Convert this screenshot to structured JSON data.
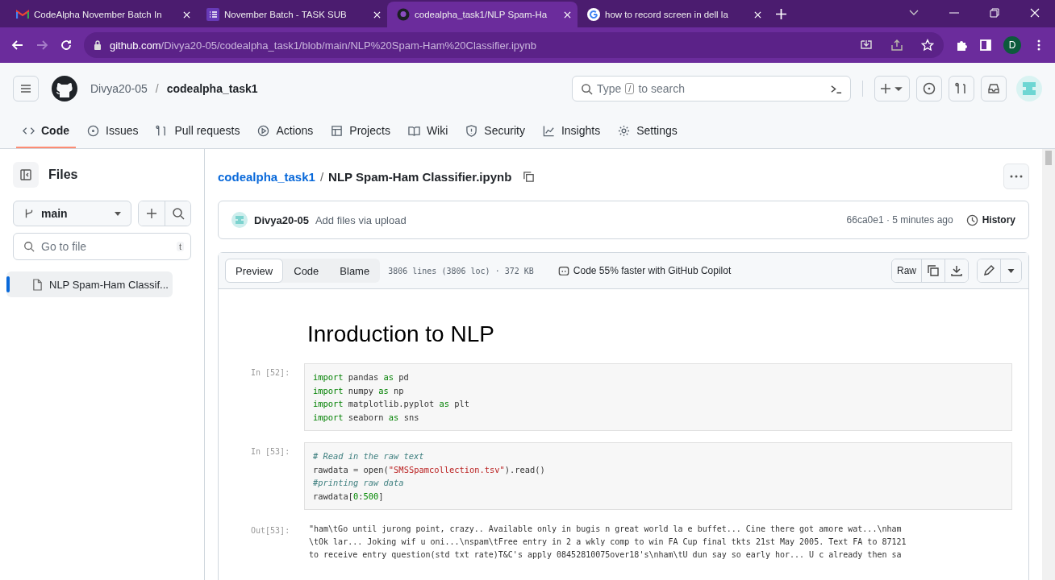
{
  "browser": {
    "tabs": [
      {
        "title": "CodeAlpha November Batch In",
        "selected": false
      },
      {
        "title": "November Batch - TASK SUB",
        "selected": false
      },
      {
        "title": "codealpha_task1/NLP Spam-Ha",
        "selected": true
      },
      {
        "title": "how to record screen in dell la",
        "selected": false
      }
    ],
    "url_host": "github.com",
    "url_path": "/Divya20-05/codealpha_task1/blob/main/NLP%20Spam-Ham%20Classifier.ipynb",
    "profile_initial": "D"
  },
  "header": {
    "owner": "Divya20-05",
    "separator": "/",
    "repo": "codealpha_task1",
    "search_placeholder_before": "Type",
    "search_key": "/",
    "search_placeholder_after": "to search"
  },
  "repo_nav": [
    {
      "label": "Code",
      "selected": true
    },
    {
      "label": "Issues",
      "selected": false
    },
    {
      "label": "Pull requests",
      "selected": false
    },
    {
      "label": "Actions",
      "selected": false
    },
    {
      "label": "Projects",
      "selected": false
    },
    {
      "label": "Wiki",
      "selected": false
    },
    {
      "label": "Security",
      "selected": false
    },
    {
      "label": "Insights",
      "selected": false
    },
    {
      "label": "Settings",
      "selected": false
    }
  ],
  "sidebar": {
    "title": "Files",
    "branch": "main",
    "filter_placeholder": "Go to file",
    "filter_key": "t",
    "files": [
      {
        "name": "NLP Spam-Ham Classif...",
        "selected": true
      }
    ]
  },
  "file": {
    "repo_link": "codealpha_task1",
    "separator": "/",
    "name": "NLP Spam-Ham Classifier.ipynb",
    "commit": {
      "author": "Divya20-05",
      "message": "Add files via upload",
      "hash_time": "66ca0e1 · 5 minutes ago",
      "history": "History"
    },
    "view_tabs": [
      {
        "label": "Preview",
        "selected": true
      },
      {
        "label": "Code",
        "selected": false
      },
      {
        "label": "Blame",
        "selected": false
      }
    ],
    "stats": "3806 lines (3806 loc) · 372 KB",
    "copilot": "Code 55% faster with GitHub Copilot",
    "raw": "Raw"
  },
  "notebook": {
    "heading": "Inroduction to NLP",
    "cells": [
      {
        "prompt": "In [52]:",
        "kind": "input",
        "lines": [
          [
            {
              "t": "import",
              "kind": "keyword"
            },
            {
              "t": " pandas ",
              "kind": "plain"
            },
            {
              "t": "as",
              "kind": "keyword"
            },
            {
              "t": " pd",
              "kind": "plain"
            }
          ],
          [
            {
              "t": "import",
              "kind": "keyword"
            },
            {
              "t": " numpy ",
              "kind": "plain"
            },
            {
              "t": "as",
              "kind": "keyword"
            },
            {
              "t": " np",
              "kind": "plain"
            }
          ],
          [
            {
              "t": "import",
              "kind": "keyword"
            },
            {
              "t": " matplotlib.pyplot ",
              "kind": "plain"
            },
            {
              "t": "as",
              "kind": "keyword"
            },
            {
              "t": " plt",
              "kind": "plain"
            }
          ],
          [
            {
              "t": "import",
              "kind": "keyword"
            },
            {
              "t": " seaborn ",
              "kind": "plain"
            },
            {
              "t": "as",
              "kind": "keyword"
            },
            {
              "t": " sns",
              "kind": "plain"
            }
          ]
        ]
      },
      {
        "prompt": "In [53]:",
        "kind": "input",
        "lines": [
          [
            {
              "t": "# Read in the raw text",
              "kind": "comment"
            }
          ],
          [
            {
              "t": "rawdata ",
              "kind": "plain"
            },
            {
              "t": "=",
              "kind": "operator"
            },
            {
              "t": " open(",
              "kind": "plain"
            },
            {
              "t": "\"SMSSpamcollection.tsv\"",
              "kind": "string"
            },
            {
              "t": ").read()",
              "kind": "plain"
            }
          ],
          [
            {
              "t": "#printing raw data",
              "kind": "comment"
            }
          ],
          [
            {
              "t": "rawdata[",
              "kind": "plain"
            },
            {
              "t": "0",
              "kind": "number"
            },
            {
              "t": ":",
              "kind": "plain"
            },
            {
              "t": "500",
              "kind": "number"
            },
            {
              "t": "]",
              "kind": "plain"
            }
          ]
        ]
      },
      {
        "prompt": "Out[53]:",
        "kind": "output",
        "lines": [
          "\"ham\\tGo until jurong point, crazy.. Available only in bugis n great world la e buffet... Cine there got amore wat...\\nham",
          "\\tOk lar... Joking wif u oni...\\nspam\\tFree entry in 2 a wkly comp to win FA Cup final tkts 21st May 2005. Text FA to 87121",
          "to receive entry question(std txt rate)T&C's apply 08452810075over18's\\nham\\tU dun say so early hor... U c already then sa"
        ]
      }
    ]
  }
}
